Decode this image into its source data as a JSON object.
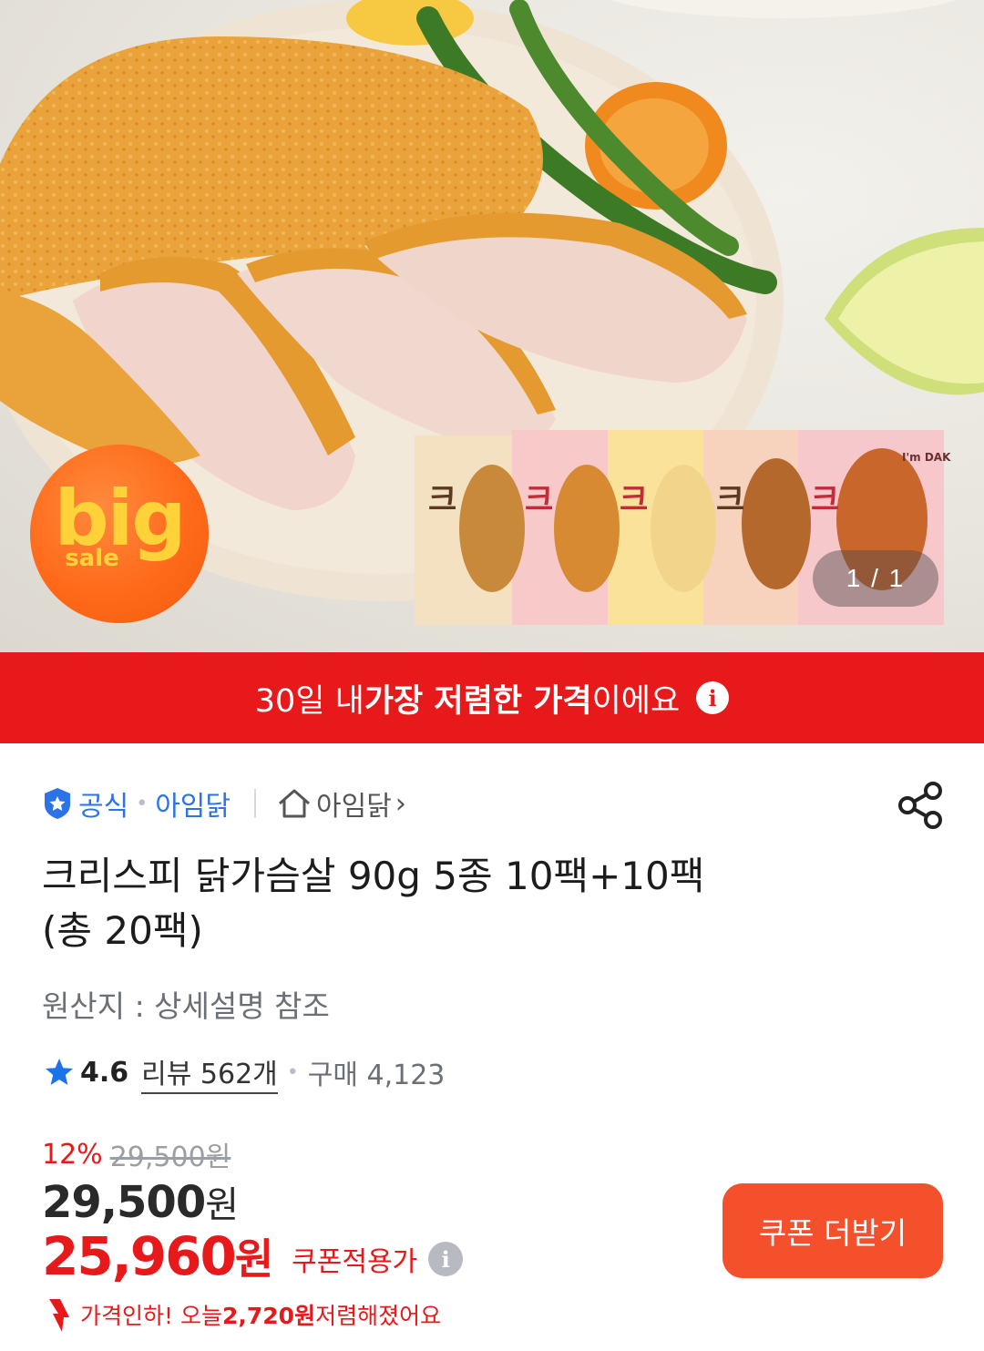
{
  "hero": {
    "badge_big": "big",
    "badge_sale": "sale",
    "image_counter": "1 / 1",
    "package_brand": "I'm DAK",
    "package_label": "크리스피"
  },
  "banner": {
    "prefix": "30일 내 ",
    "highlight": "가장 저렴한 가격",
    "suffix": "이에요",
    "info_icon": "info-icon"
  },
  "seller": {
    "official_label": "공식",
    "brand_name": "아임닭",
    "store_name": "아임닭",
    "chevron": "›"
  },
  "product": {
    "title_line1": "크리스피 닭가슴살 90g 5종 10팩+10팩",
    "title_line2": "(총 20팩)",
    "origin": "원산지 : 상세설명 참조"
  },
  "rating": {
    "score": "4.6",
    "reviews": "리뷰 562개",
    "purchases": "구매 4,123"
  },
  "price": {
    "discount_rate": "12%",
    "original_price": "29,500원",
    "sale_price": "29,500",
    "sale_currency": "원",
    "coupon_price": "25,960",
    "coupon_currency": "원",
    "coupon_label": "쿠폰적용가",
    "drop_prefix": "가격인하! 오늘 ",
    "drop_amount": "2,720원",
    "drop_suffix": " 저렴해졌어요"
  },
  "actions": {
    "coupon_button": "쿠폰 더받기"
  },
  "colors": {
    "accent_red": "#e8191b",
    "coupon_button": "#f4502c",
    "link_blue": "#2b73e6",
    "star_blue": "#1a73e8"
  }
}
